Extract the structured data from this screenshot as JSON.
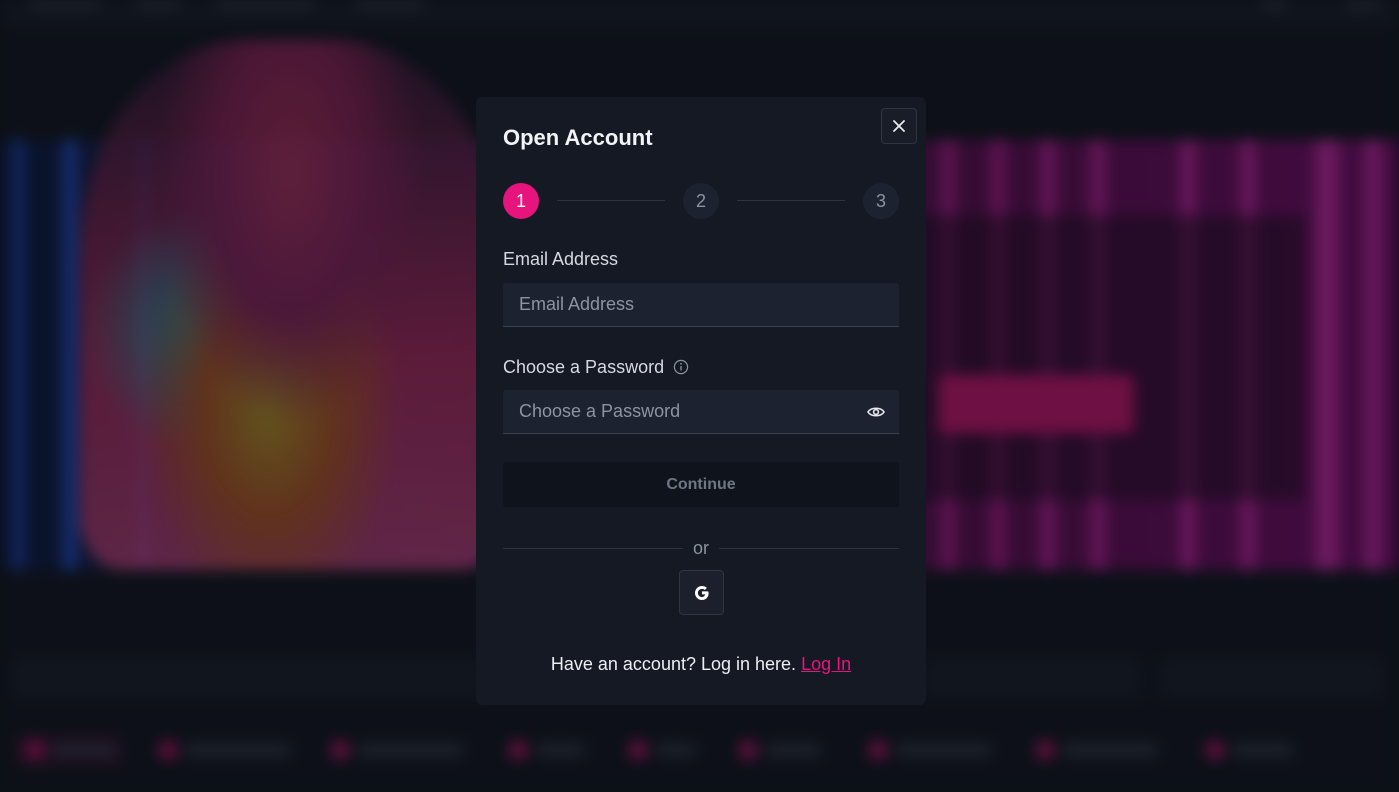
{
  "modal": {
    "title": "Open Account",
    "close_icon": "close-icon",
    "steps": [
      "1",
      "2",
      "3"
    ],
    "active_step": 1,
    "email": {
      "label": "Email Address",
      "placeholder": "Email Address",
      "value": ""
    },
    "password": {
      "label": "Choose a Password",
      "placeholder": "Choose a Password",
      "value": "",
      "info_icon": "info-icon",
      "toggle_icon": "eye-icon"
    },
    "continue_label": "Continue",
    "divider_text": "or",
    "social_icon": "google-icon",
    "footer": {
      "text": "Have an account? Log in here.",
      "link_label": "Log In"
    }
  },
  "colors": {
    "accent": "#e8147e",
    "modal_bg": "#141923",
    "input_bg": "#1c2230"
  }
}
